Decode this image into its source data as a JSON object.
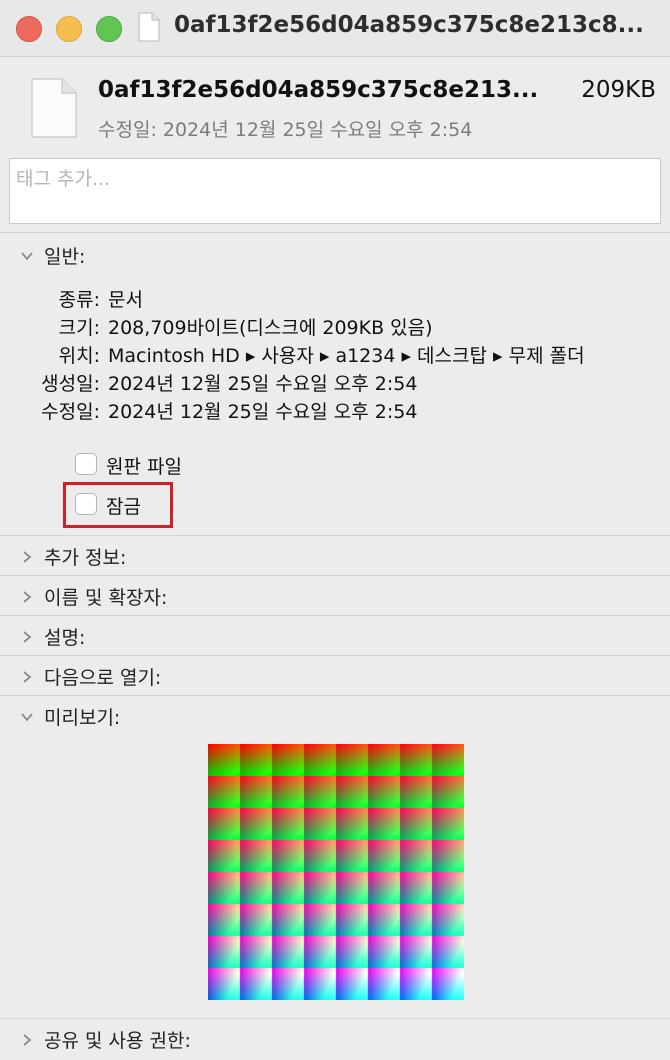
{
  "window": {
    "title": "0af13f2e56d04a859c375c8e213c8...",
    "icon": "document-icon"
  },
  "header": {
    "filename": "0af13f2e56d04a859c375c8e213...",
    "size": "209KB",
    "modified": "수정일: 2024년 12월 25일 수요일 오후 2:54"
  },
  "tags": {
    "placeholder": "태그 추가..."
  },
  "general": {
    "label": "일반:",
    "expanded": true,
    "kind_label": "종류:",
    "kind_value": "문서",
    "size_label": "크기:",
    "size_value": "208,709바이트(디스크에 209KB 있음)",
    "where_label": "위치:",
    "where_value": "Macintosh HD ▸ 사용자 ▸ a1234 ▸ 데스크탑 ▸ 무제 폴더",
    "created_label": "생성일:",
    "created_value": "2024년 12월 25일 수요일 오후 2:54",
    "modified_label": "수정일:",
    "modified_value": "2024년 12월 25일 수요일 오후 2:54",
    "stationery_label": "원판 파일",
    "stationery_checked": false,
    "locked_label": "잠금",
    "locked_checked": false
  },
  "sections": {
    "more_info": "추가 정보:",
    "name_ext": "이름 및 확장자:",
    "comments": "설명:",
    "open_with": "다음으로 열기:",
    "preview": "미리보기:",
    "sharing": "공유 및 사용 권한:"
  },
  "colors": {
    "highlight": "#d0202a",
    "close": "#ed6a5e",
    "minimize": "#f5bf4f",
    "zoom": "#61c554"
  }
}
